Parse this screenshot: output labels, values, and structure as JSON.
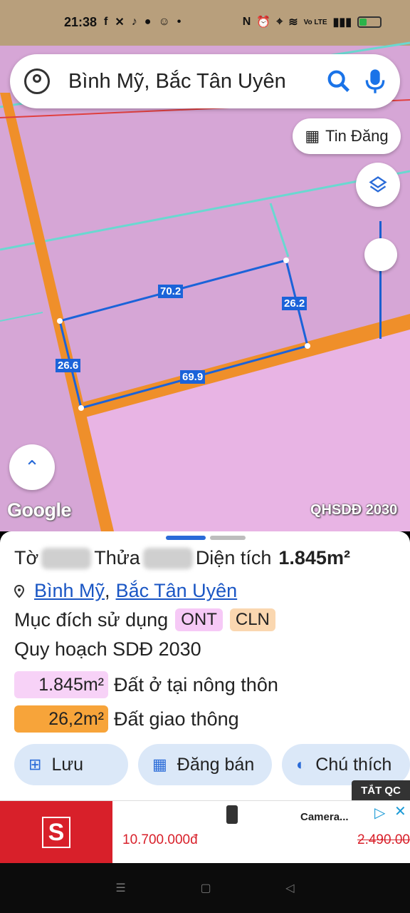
{
  "status_bar": {
    "time": "21:38",
    "network": "Vo LTE"
  },
  "search": {
    "query": "Bình Mỹ, Bắc Tân Uyên"
  },
  "map": {
    "tin_dang_label": "Tin Đăng",
    "google_label": "Google",
    "layer_label": "QHSDĐ 2030",
    "measurements": {
      "top": "70.2",
      "right": "26.2",
      "left": "26.6",
      "bottom": "69.9"
    }
  },
  "panel": {
    "to_label": "Tờ",
    "thua_label": "Thửa",
    "area_label": "Diện tích",
    "area_value": "1.845m²",
    "location_commune": "Bình Mỹ",
    "location_sep": ",",
    "location_district": "Bắc Tân Uyên",
    "purpose_label": "Mục đích sử dụng",
    "purpose_tags": [
      "ONT",
      "CLN"
    ],
    "plan_label": "Quy hoạch SDĐ 2030",
    "plan_items": [
      {
        "value": "1.845m²",
        "desc": "Đất ở tại nông thôn",
        "color": "#f7d2f7"
      },
      {
        "value": "26,2m²",
        "desc": "Đất giao thông",
        "color": "#f7a43a"
      }
    ],
    "actions": {
      "save": "Lưu",
      "sell": "Đăng bán",
      "legend": "Chú thích"
    }
  },
  "ad": {
    "tat_qc": "TẮT QC",
    "title": "Camera...",
    "price": "10.700.000đ",
    "old_price": "2.490.00"
  },
  "colors": {
    "accent": "#2a6bd8",
    "land_pink": "#d8a8d8",
    "road_orange": "#f0922a",
    "plot_line": "#1b63d9"
  }
}
